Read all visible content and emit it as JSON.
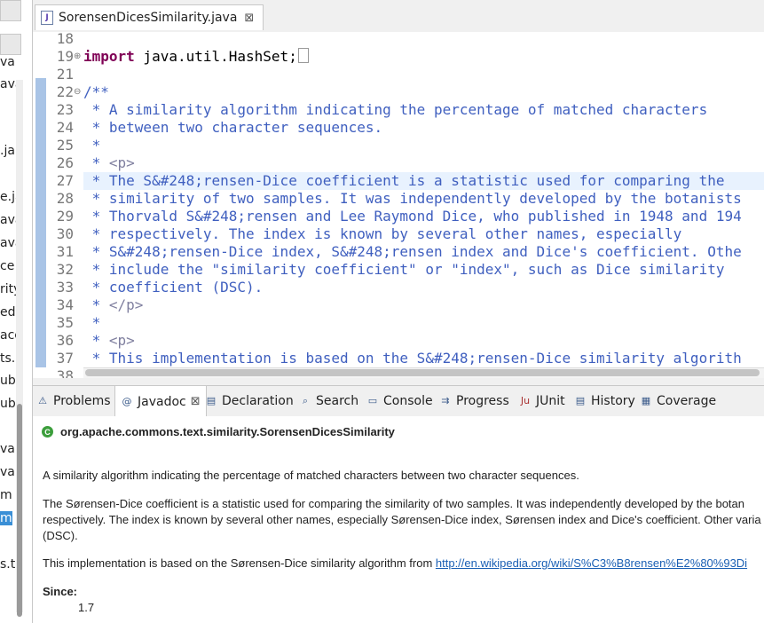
{
  "left_panel": {
    "fragments": [
      "va",
      "ava",
      "",
      "",
      ".ja",
      "",
      "e.ja",
      "ava",
      "ava",
      "ce",
      "rity",
      "ed",
      "ace",
      "ts.",
      "ub",
      "ub",
      "",
      "va",
      "va",
      "m",
      "m",
      "",
      "s.t"
    ]
  },
  "editor": {
    "tab_title": "SorensenDicesSimilarity.java",
    "lines": [
      {
        "num": "18",
        "text": ""
      },
      {
        "num": "19",
        "text": "import java.util.HashSet;",
        "fold": "⊕"
      },
      {
        "num": "21",
        "text": ""
      },
      {
        "num": "22",
        "text": "/**",
        "fold": "⊖"
      },
      {
        "num": "23",
        "text": " * A similarity algorithm indicating the percentage of matched characters"
      },
      {
        "num": "24",
        "text": " * between two character sequences."
      },
      {
        "num": "25",
        "text": " *"
      },
      {
        "num": "26",
        "text": " * <p>"
      },
      {
        "num": "27",
        "text": " * The S&#248;rensen-Dice coefficient is a statistic used for comparing the"
      },
      {
        "num": "28",
        "text": " * similarity of two samples. It was independently developed by the botanists"
      },
      {
        "num": "29",
        "text": " * Thorvald S&#248;rensen and Lee Raymond Dice, who published in 1948 and 194"
      },
      {
        "num": "30",
        "text": " * respectively. The index is known by several other names, especially"
      },
      {
        "num": "31",
        "text": " * S&#248;rensen-Dice index, S&#248;rensen index and Dice's coefficient. Othe"
      },
      {
        "num": "32",
        "text": " * include the \"similarity coefficient\" or \"index\", such as Dice similarity"
      },
      {
        "num": "33",
        "text": " * coefficient (DSC)."
      },
      {
        "num": "34",
        "text": " * </p>"
      },
      {
        "num": "35",
        "text": " *"
      },
      {
        "num": "36",
        "text": " * <p>"
      },
      {
        "num": "37",
        "text": " * This implementation is based on the S&#248;rensen-Dice similarity algorith"
      },
      {
        "num": "38",
        "text": ""
      }
    ]
  },
  "panel_tabs": [
    {
      "label": "Problems",
      "icon": "problems-icon"
    },
    {
      "label": "Javadoc",
      "icon": "javadoc-icon",
      "active": true
    },
    {
      "label": "Declaration",
      "icon": "declaration-icon"
    },
    {
      "label": "Search",
      "icon": "search-icon"
    },
    {
      "label": "Console",
      "icon": "console-icon"
    },
    {
      "label": "Progress",
      "icon": "progress-icon"
    },
    {
      "label": "JUnit",
      "icon": "junit-icon"
    },
    {
      "label": "History",
      "icon": "history-icon"
    },
    {
      "label": "Coverage",
      "icon": "coverage-icon"
    }
  ],
  "javadoc": {
    "class_name": "org.apache.commons.text.similarity.SorensenDicesSimilarity",
    "para1": "A similarity algorithm indicating the percentage of matched characters between two character sequences.",
    "para2_line1": "The Sørensen-Dice coefficient is a statistic used for comparing the similarity of two samples. It was independently developed by the botan",
    "para2_line2": "respectively. The index is known by several other names, especially Sørensen-Dice index, Sørensen index and Dice's coefficient. Other varia",
    "para2_line3": "(DSC).",
    "para3_text": "This implementation is based on the Sørensen-Dice similarity algorithm from ",
    "para3_link": "http://en.wikipedia.org/wiki/S%C3%B8rensen%E2%80%93Di",
    "since_label": "Since:",
    "since_value": "1.7"
  }
}
